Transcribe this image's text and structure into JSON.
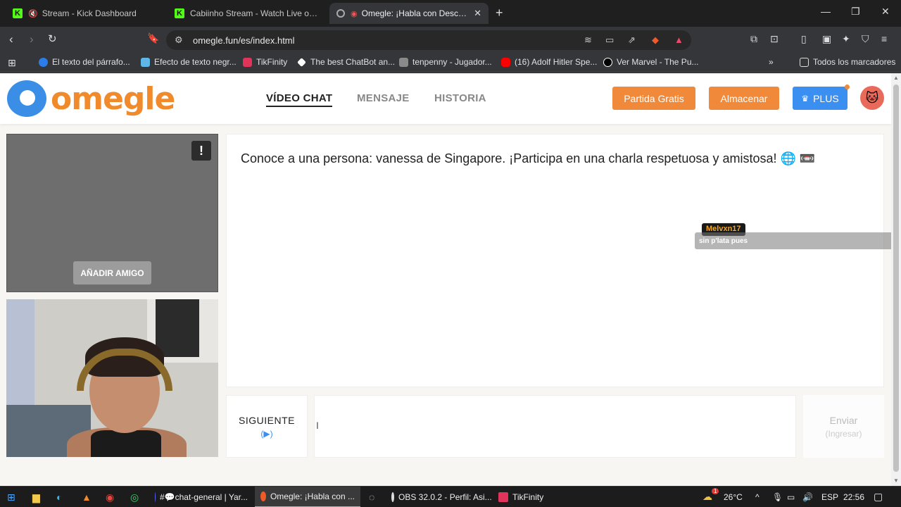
{
  "browser": {
    "tabs": [
      {
        "title": "Stream - Kick Dashboard",
        "favicon": "kick-icon",
        "muted": true
      },
      {
        "title": "Cabiinho Stream - Watch Live on Kick",
        "favicon": "kick-icon"
      },
      {
        "title": "Omegle: ¡Habla con Desconocidos!",
        "favicon": "omegle-icon",
        "active": true,
        "recording": true
      }
    ],
    "new_tab": "+",
    "url": "omegle.fun/es/index.html",
    "bookmarks": [
      {
        "label": "El texto del párrafo..."
      },
      {
        "label": "Efecto de texto negr..."
      },
      {
        "label": "TikFinity"
      },
      {
        "label": "The best ChatBot an..."
      },
      {
        "label": "tenpenny - Jugador..."
      },
      {
        "label": "(16) Adolf Hitler Spe..."
      },
      {
        "label": "Ver Marvel - The Pu..."
      }
    ],
    "bookmarks_folder": "Todos los marcadores",
    "more": "»"
  },
  "site": {
    "logo_text": "omegle",
    "nav": [
      {
        "label": "VÍDEO CHAT",
        "active": true
      },
      {
        "label": "MENSAJE"
      },
      {
        "label": "HISTORIA"
      }
    ],
    "btn_free": "Partida Gratis",
    "btn_store": "Almacenar",
    "btn_plus": "PLUS",
    "add_friend": "AÑADIR AMIGO",
    "report": "!",
    "chat_intro": "Conoce a una persona: vanessa de Singapore. ¡Participa en una charla respetuosa y amistosa! 🌐 📼",
    "next_label": "SIGUIENTE",
    "next_key": "(▶)",
    "send_label": "Enviar",
    "send_key": "(Ingresar)"
  },
  "overlay": {
    "username": "Melvxn17",
    "message": "sin p'lata pues"
  },
  "taskbar": {
    "tasks": [
      {
        "label": "#💬chat-general | Yar..."
      },
      {
        "label": "Omegle: ¡Habla con ...",
        "active": true
      },
      {
        "label": "OBS 32.0.2 - Perfil: Asi..."
      },
      {
        "label": "TikFinity"
      }
    ],
    "weather": "26°C",
    "lang": "ESP",
    "time": "22:56",
    "weather_badge": "1"
  },
  "colors": {
    "accent_orange": "#f08a3a",
    "accent_blue": "#3b8ff0",
    "kick_green": "#53fc18"
  }
}
